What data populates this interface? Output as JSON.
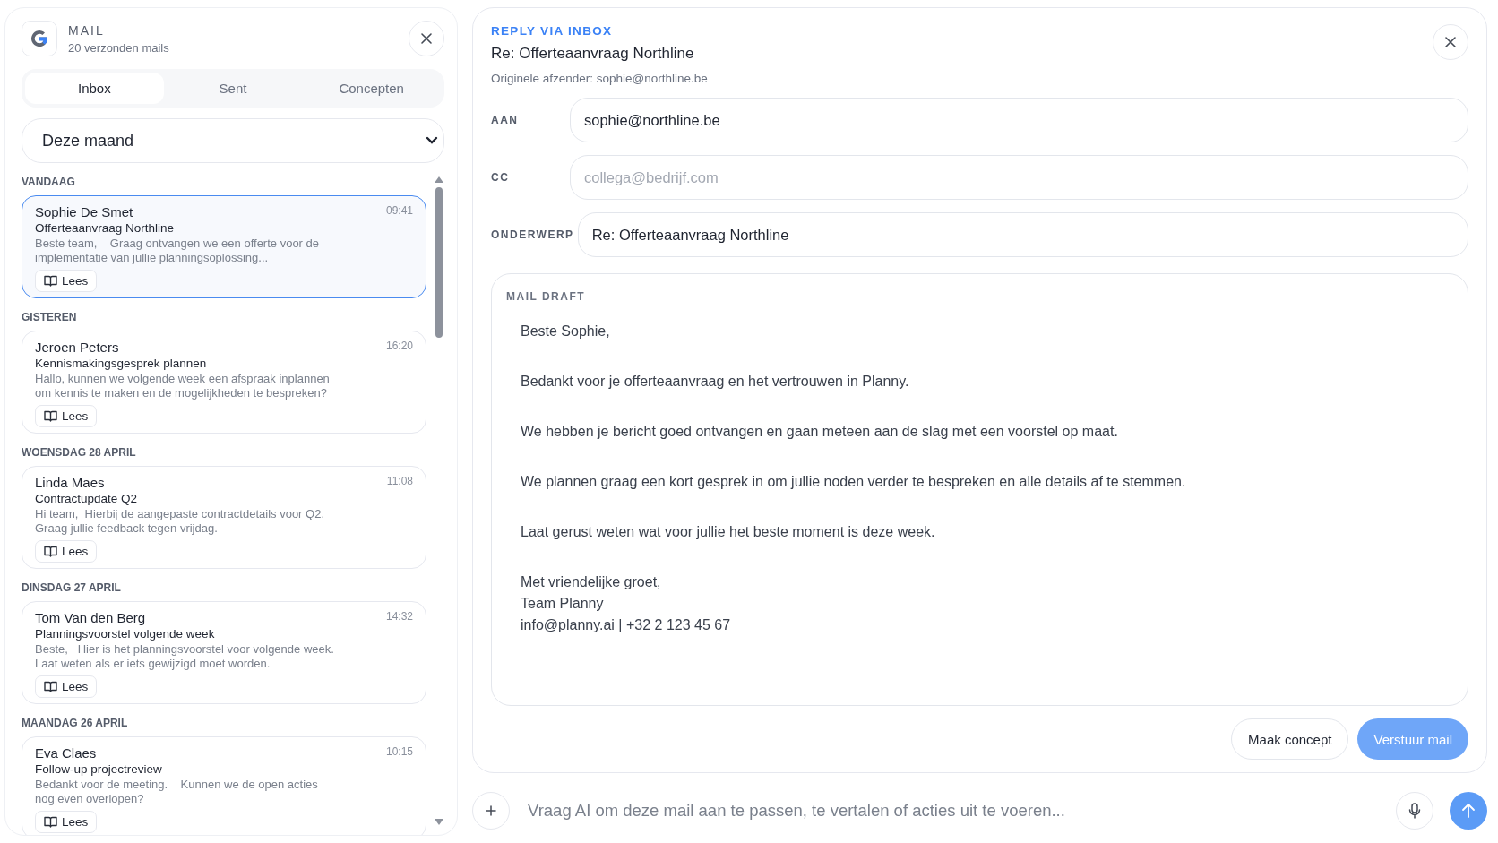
{
  "sidebar": {
    "app_title": "MAIL",
    "subtitle": "20 verzonden mails",
    "tabs": [
      {
        "label": "Inbox",
        "selected": true
      },
      {
        "label": "Sent",
        "selected": false
      },
      {
        "label": "Concepten",
        "selected": false
      }
    ],
    "period_select": {
      "value": "Deze maand"
    },
    "groups": [
      {
        "heading": "VANDAAG",
        "mails": [
          {
            "sender": "Sophie De Smet",
            "time": "09:41",
            "subject": "Offerteaanvraag Northline",
            "preview": "Beste team,    Graag ontvangen we een offerte voor de implementatie van jullie planningsoplossing...",
            "action": "Lees",
            "selected": true
          }
        ]
      },
      {
        "heading": "GISTEREN",
        "mails": [
          {
            "sender": "Jeroen Peters",
            "time": "16:20",
            "subject": "Kennismakingsgesprek plannen",
            "preview": "Hallo, kunnen we volgende week een afspraak inplannen om kennis te maken en de mogelijkheden te bespreken?",
            "action": "Lees",
            "selected": false
          }
        ]
      },
      {
        "heading": "WOENSDAG 28 APRIL",
        "mails": [
          {
            "sender": "Linda Maes",
            "time": "11:08",
            "subject": "Contractupdate Q2",
            "preview": "Hi team,  Hierbij de aangepaste contractdetails voor Q2. Graag jullie feedback tegen vrijdag.",
            "action": "Lees",
            "selected": false
          }
        ]
      },
      {
        "heading": "DINSDAG 27 APRIL",
        "mails": [
          {
            "sender": "Tom Van den Berg",
            "time": "14:32",
            "subject": "Planningsvoorstel volgende week",
            "preview": "Beste,   Hier is het planningsvoorstel voor volgende week. Laat weten als er iets gewijzigd moet worden.",
            "action": "Lees",
            "selected": false
          }
        ]
      },
      {
        "heading": "MAANDAG 26 APRIL",
        "mails": [
          {
            "sender": "Eva Claes",
            "time": "10:15",
            "subject": "Follow-up projectreview",
            "preview": "Bedankt voor de meeting.    Kunnen we de open acties nog even overlopen?",
            "action": "Lees",
            "selected": false
          }
        ]
      }
    ]
  },
  "reply": {
    "eyebrow": "REPLY VIA INBOX",
    "title": "Re: Offerteaanvraag Northline",
    "original_sender": "Originele afzender: sophie@northline.be",
    "fields": [
      {
        "label": "AAN",
        "value": "sophie@northline.be"
      },
      {
        "label": "CC",
        "placeholder": "collega@bedrijf.com"
      },
      {
        "label": "ONDERWERP",
        "value": "Re: Offerteaanvraag Northline"
      }
    ],
    "draft": {
      "label": "MAIL DRAFT",
      "paragraphs": [
        [
          "Beste Sophie,"
        ],
        [
          "Bedankt voor je offerteaanvraag en het vertrouwen in Planny."
        ],
        [
          "We hebben je bericht goed ontvangen en gaan meteen aan de slag met een voorstel op maat."
        ],
        [
          "We plannen graag een kort gesprek in om jullie noden verder te bespreken en alle details af te stemmen."
        ],
        [
          "Laat gerust weten wat voor jullie het beste moment is deze week."
        ],
        [
          "Met vriendelijke groet,",
          "Team Planny",
          "info@planny.ai | +32 2 123 45 67"
        ]
      ]
    },
    "buttons": [
      {
        "label": "Maak concept",
        "kind": "secondary"
      },
      {
        "label": "Verstuur mail",
        "kind": "primary"
      }
    ]
  },
  "ai_bar": {
    "placeholder": "Vraag AI om deze mail aan te passen, te vertalen of acties uit te voeren..."
  }
}
